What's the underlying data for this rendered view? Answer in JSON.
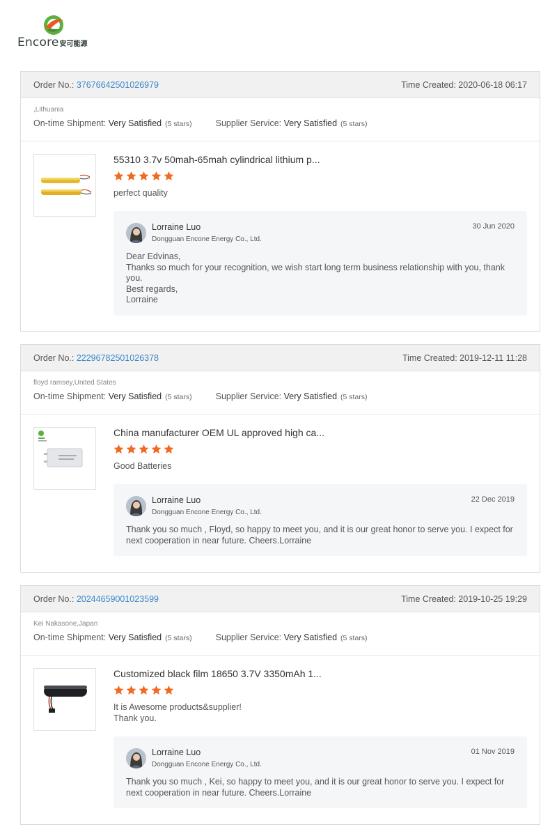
{
  "brand": {
    "name": "Encore",
    "name_cn": "安可能源"
  },
  "labels": {
    "order_no": "Order No.: ",
    "time_created": "Time Created: ",
    "ontime": "On-time Shipment: ",
    "supplier": "Supplier Service: "
  },
  "colors": {
    "accent": "#3a86c8",
    "star": "#f26a22",
    "card_head": "#f1f1f1",
    "reply_bg": "#f5f6f8"
  },
  "reviews": [
    {
      "order_no": "37676642501026979",
      "time_created": "2020-06-18 06:17",
      "buyer": ",Lithuania",
      "ontime_value": "Very Satisfied",
      "ontime_stars": "(5 stars)",
      "supplier_value": "Very Satisfied",
      "supplier_stars": "(5 stars)",
      "product_title": "55310 3.7v 50mah-65mah cylindrical lithium p...",
      "rating": 5,
      "comment": "perfect quality",
      "reply": {
        "name": "Lorraine Luo",
        "company": "Dongguan Encone Energy Co., Ltd.",
        "date": "30 Jun 2020",
        "text": "Dear Edvinas,\nThanks so much for your recognition,  we wish start long term business relationship with you, thank you.\nBest regards,\nLorraine"
      },
      "thumb_icon": "cylindrical-battery-image"
    },
    {
      "order_no": "22296782501026378",
      "time_created": "2019-12-11 11:28",
      "buyer": "floyd ramsey,United States",
      "ontime_value": "Very Satisfied",
      "ontime_stars": "(5 stars)",
      "supplier_value": "Very Satisfied",
      "supplier_stars": "(5 stars)",
      "product_title": "China manufacturer OEM UL approved high ca...",
      "rating": 5,
      "comment": "Good Batteries",
      "reply": {
        "name": "Lorraine Luo",
        "company": "Dongguan Encone Energy Co., Ltd.",
        "date": "22 Dec 2019",
        "text": "Thank you so much , Floyd, so happy to meet you,  and it is our great honor to serve you. I expect for next cooperation in near future. Cheers.Lorraine"
      },
      "thumb_icon": "pouch-battery-image"
    },
    {
      "order_no": "20244659001023599",
      "time_created": "2019-10-25 19:29",
      "buyer": "Kei Nakasone,Japan",
      "ontime_value": "Very Satisfied",
      "ontime_stars": "(5 stars)",
      "supplier_value": "Very Satisfied",
      "supplier_stars": "(5 stars)",
      "product_title": "Customized black film 18650 3.7V 3350mAh 1...",
      "rating": 5,
      "comment": "It is Awesome products&supplier!\nThank you.",
      "reply": {
        "name": "Lorraine Luo",
        "company": "Dongguan Encone Energy Co., Ltd.",
        "date": "01 Nov 2019",
        "text": "Thank you so much , Kei, so happy to meet you,  and it is our great honor to serve you. I expect for next cooperation in near future. Cheers.Lorraine"
      },
      "thumb_icon": "black-18650-battery-image"
    }
  ]
}
